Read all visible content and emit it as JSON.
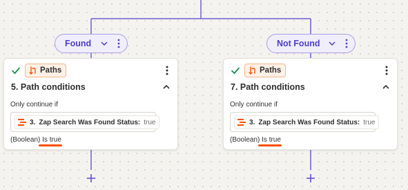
{
  "paths": [
    {
      "pill_label": "Found",
      "card": {
        "app_label": "Paths",
        "step_number": "5.",
        "step_title": "Path conditions",
        "subtitle": "Only continue if",
        "chip_step": "3.",
        "chip_field": "Zap Search Was Found Status:",
        "chip_value": "true",
        "footer_type": "(Boolean)",
        "footer_op": "Is true"
      }
    },
    {
      "pill_label": "Not Found",
      "card": {
        "app_label": "Paths",
        "step_number": "7.",
        "step_title": "Path conditions",
        "subtitle": "Only continue if",
        "chip_step": "3.",
        "chip_field": "Zap Search Was Found Status:",
        "chip_value": "true",
        "footer_type": "(Boolean)",
        "footer_op": "Is true"
      }
    }
  ],
  "colors": {
    "connector": "#6b5fd3",
    "pill_border": "#a89de3",
    "pill_text": "#4d3fc4",
    "check": "#1f8a4c",
    "brand_orange": "#ff4f00",
    "card_border": "#e6e2db"
  },
  "icons": {
    "pill_dropdown": "chevron-down-icon",
    "pill_menu": "kebab-icon",
    "status": "check-icon",
    "app": "paths-branch-icon",
    "collapse": "chevron-up-icon",
    "add": "plus-icon"
  }
}
